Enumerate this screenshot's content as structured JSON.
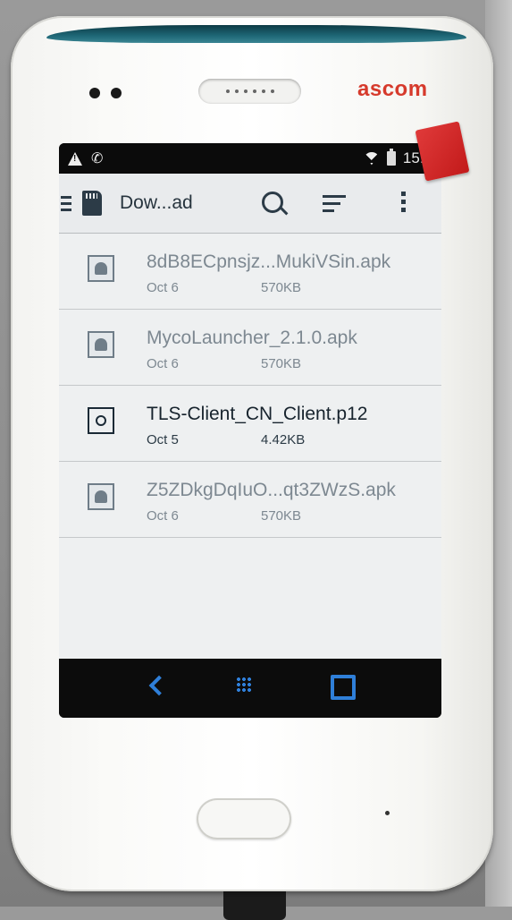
{
  "device": {
    "brand": "ascom"
  },
  "status_bar": {
    "time": "15:5"
  },
  "toolbar": {
    "title": "Dow...ad"
  },
  "files": [
    {
      "name": "8dB8ECpnsjz...MukiVSin.apk",
      "date": "Oct 6",
      "size": "570KB",
      "icon": "android-apk-icon",
      "enabled": false
    },
    {
      "name": "MycoLauncher_2.1.0.apk",
      "date": "Oct 6",
      "size": "570KB",
      "icon": "android-apk-icon",
      "enabled": false
    },
    {
      "name": "TLS-Client_CN_Client.p12",
      "date": "Oct 5",
      "size": "4.42KB",
      "icon": "certificate-icon",
      "enabled": true
    },
    {
      "name": "Z5ZDkgDqIuO...qt3ZWzS.apk",
      "date": "Oct 6",
      "size": "570KB",
      "icon": "android-apk-icon",
      "enabled": false
    }
  ],
  "colors": {
    "accent_nav": "#2f7fd9",
    "brand_red": "#d63a2c",
    "toolbar_bg": "#e9ebed"
  }
}
